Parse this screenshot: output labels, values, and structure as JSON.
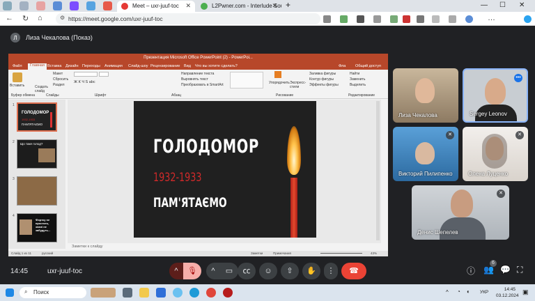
{
  "browser": {
    "tabs": [
      {
        "label": "Meet – uxr-juuf-toc",
        "active": true
      },
      {
        "label": "L2Pwner.com - Interlude Soul Nx",
        "active": false
      }
    ],
    "new_tab": "+",
    "url": "https://meet.google.com/uxr-juuf-toc",
    "window_controls": [
      "—",
      "☐",
      "✕"
    ]
  },
  "meet": {
    "presenter_label": "Лиза Чекалова (Показ)",
    "meeting_time": "14:45",
    "meeting_code": "uxr-juuf-toc",
    "participant_badge": "6",
    "participants": [
      {
        "name": "Лиза Чекалова"
      },
      {
        "name": "Sergey Leonov"
      },
      {
        "name": "Викторий Пилипенко"
      },
      {
        "name": "Олена Луценко"
      },
      {
        "name": "Денис Шепелев"
      }
    ]
  },
  "ppt": {
    "window_title": "Презентация Microsoft Office PowerPoint (2) - PowerPoi...",
    "ribbon_tabs": [
      "Файл",
      "Главная",
      "Вставка",
      "Дизайн",
      "Переходы",
      "Анимация",
      "Слайд-шоу",
      "Рецензирование",
      "Вид",
      "Что вы хотите сделать?"
    ],
    "user": "Фла",
    "share": "Общий доступ",
    "groups": [
      "Буфер обмена",
      "Слайды",
      "Шрифт",
      "Абзац",
      "Рисование",
      "Редактирование"
    ],
    "ribbon_items": {
      "paste": "Вставить",
      "new_slide": "Создать слайд",
      "layout": "Макет",
      "reset": "Сбросить",
      "section": "Раздел",
      "text_dir": "Направление текста",
      "align_text": "Выровнять текст",
      "smartart": "Преобразовать в SmartArt",
      "arrange": "Упорядочить",
      "styles": "Экспресс-стили",
      "fill": "Заливка фигуры",
      "outline": "Контур фигуры",
      "effects": "Эффекты фигуры",
      "find": "Найти",
      "replace": "Заменить",
      "select": "Выделить"
    },
    "thumb_numbers": [
      "1",
      "2",
      "3",
      "4"
    ],
    "thumb2_title": "Що таке голод?",
    "thumb4_text": "Фортку не простить, знані не забудуть...",
    "slide": {
      "title": "ГОЛОДОМОР",
      "years": "1932-1933",
      "subtitle": "ПАМ'ЯТАЄМО"
    },
    "notes": "Заметки к слайду",
    "status": {
      "slide_count": "Слайд 1 из 11",
      "language": "русский",
      "notes_btn": "Заметки",
      "comments": "Примечания",
      "zoom": "43%"
    }
  },
  "taskbar": {
    "search_placeholder": "Поиск",
    "language": "УКР",
    "time": "14:45",
    "date": "03.12.2024"
  },
  "colors": {
    "meet_bg": "#202124",
    "end_call": "#ea4335",
    "mic_off": "#ea4335",
    "ppt_accent": "#b7472a"
  }
}
